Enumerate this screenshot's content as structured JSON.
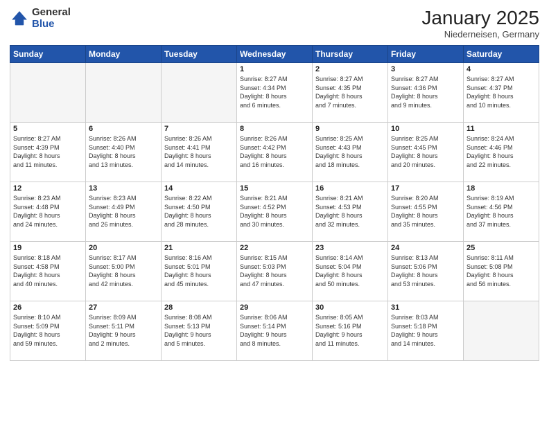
{
  "logo": {
    "general": "General",
    "blue": "Blue"
  },
  "header": {
    "month": "January 2025",
    "location": "Niederneisen, Germany"
  },
  "weekdays": [
    "Sunday",
    "Monday",
    "Tuesday",
    "Wednesday",
    "Thursday",
    "Friday",
    "Saturday"
  ],
  "weeks": [
    [
      {
        "day": "",
        "detail": ""
      },
      {
        "day": "",
        "detail": ""
      },
      {
        "day": "",
        "detail": ""
      },
      {
        "day": "1",
        "detail": "Sunrise: 8:27 AM\nSunset: 4:34 PM\nDaylight: 8 hours\nand 6 minutes."
      },
      {
        "day": "2",
        "detail": "Sunrise: 8:27 AM\nSunset: 4:35 PM\nDaylight: 8 hours\nand 7 minutes."
      },
      {
        "day": "3",
        "detail": "Sunrise: 8:27 AM\nSunset: 4:36 PM\nDaylight: 8 hours\nand 9 minutes."
      },
      {
        "day": "4",
        "detail": "Sunrise: 8:27 AM\nSunset: 4:37 PM\nDaylight: 8 hours\nand 10 minutes."
      }
    ],
    [
      {
        "day": "5",
        "detail": "Sunrise: 8:27 AM\nSunset: 4:39 PM\nDaylight: 8 hours\nand 11 minutes."
      },
      {
        "day": "6",
        "detail": "Sunrise: 8:26 AM\nSunset: 4:40 PM\nDaylight: 8 hours\nand 13 minutes."
      },
      {
        "day": "7",
        "detail": "Sunrise: 8:26 AM\nSunset: 4:41 PM\nDaylight: 8 hours\nand 14 minutes."
      },
      {
        "day": "8",
        "detail": "Sunrise: 8:26 AM\nSunset: 4:42 PM\nDaylight: 8 hours\nand 16 minutes."
      },
      {
        "day": "9",
        "detail": "Sunrise: 8:25 AM\nSunset: 4:43 PM\nDaylight: 8 hours\nand 18 minutes."
      },
      {
        "day": "10",
        "detail": "Sunrise: 8:25 AM\nSunset: 4:45 PM\nDaylight: 8 hours\nand 20 minutes."
      },
      {
        "day": "11",
        "detail": "Sunrise: 8:24 AM\nSunset: 4:46 PM\nDaylight: 8 hours\nand 22 minutes."
      }
    ],
    [
      {
        "day": "12",
        "detail": "Sunrise: 8:23 AM\nSunset: 4:48 PM\nDaylight: 8 hours\nand 24 minutes."
      },
      {
        "day": "13",
        "detail": "Sunrise: 8:23 AM\nSunset: 4:49 PM\nDaylight: 8 hours\nand 26 minutes."
      },
      {
        "day": "14",
        "detail": "Sunrise: 8:22 AM\nSunset: 4:50 PM\nDaylight: 8 hours\nand 28 minutes."
      },
      {
        "day": "15",
        "detail": "Sunrise: 8:21 AM\nSunset: 4:52 PM\nDaylight: 8 hours\nand 30 minutes."
      },
      {
        "day": "16",
        "detail": "Sunrise: 8:21 AM\nSunset: 4:53 PM\nDaylight: 8 hours\nand 32 minutes."
      },
      {
        "day": "17",
        "detail": "Sunrise: 8:20 AM\nSunset: 4:55 PM\nDaylight: 8 hours\nand 35 minutes."
      },
      {
        "day": "18",
        "detail": "Sunrise: 8:19 AM\nSunset: 4:56 PM\nDaylight: 8 hours\nand 37 minutes."
      }
    ],
    [
      {
        "day": "19",
        "detail": "Sunrise: 8:18 AM\nSunset: 4:58 PM\nDaylight: 8 hours\nand 40 minutes."
      },
      {
        "day": "20",
        "detail": "Sunrise: 8:17 AM\nSunset: 5:00 PM\nDaylight: 8 hours\nand 42 minutes."
      },
      {
        "day": "21",
        "detail": "Sunrise: 8:16 AM\nSunset: 5:01 PM\nDaylight: 8 hours\nand 45 minutes."
      },
      {
        "day": "22",
        "detail": "Sunrise: 8:15 AM\nSunset: 5:03 PM\nDaylight: 8 hours\nand 47 minutes."
      },
      {
        "day": "23",
        "detail": "Sunrise: 8:14 AM\nSunset: 5:04 PM\nDaylight: 8 hours\nand 50 minutes."
      },
      {
        "day": "24",
        "detail": "Sunrise: 8:13 AM\nSunset: 5:06 PM\nDaylight: 8 hours\nand 53 minutes."
      },
      {
        "day": "25",
        "detail": "Sunrise: 8:11 AM\nSunset: 5:08 PM\nDaylight: 8 hours\nand 56 minutes."
      }
    ],
    [
      {
        "day": "26",
        "detail": "Sunrise: 8:10 AM\nSunset: 5:09 PM\nDaylight: 8 hours\nand 59 minutes."
      },
      {
        "day": "27",
        "detail": "Sunrise: 8:09 AM\nSunset: 5:11 PM\nDaylight: 9 hours\nand 2 minutes."
      },
      {
        "day": "28",
        "detail": "Sunrise: 8:08 AM\nSunset: 5:13 PM\nDaylight: 9 hours\nand 5 minutes."
      },
      {
        "day": "29",
        "detail": "Sunrise: 8:06 AM\nSunset: 5:14 PM\nDaylight: 9 hours\nand 8 minutes."
      },
      {
        "day": "30",
        "detail": "Sunrise: 8:05 AM\nSunset: 5:16 PM\nDaylight: 9 hours\nand 11 minutes."
      },
      {
        "day": "31",
        "detail": "Sunrise: 8:03 AM\nSunset: 5:18 PM\nDaylight: 9 hours\nand 14 minutes."
      },
      {
        "day": "",
        "detail": ""
      }
    ]
  ]
}
